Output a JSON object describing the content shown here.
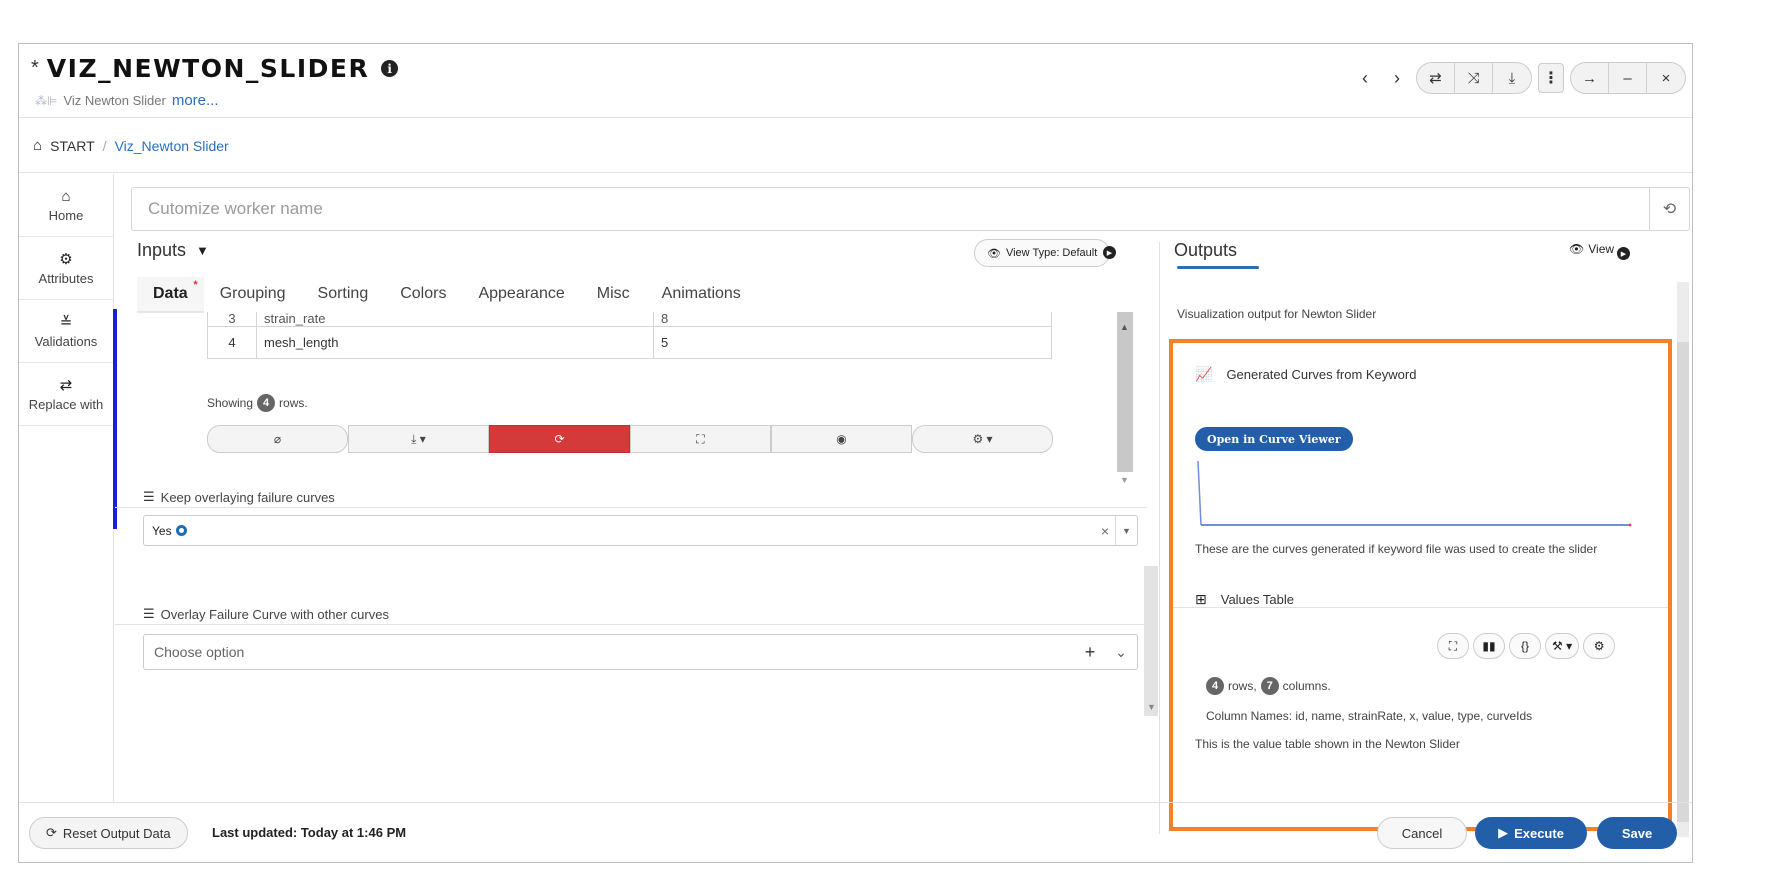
{
  "window": {
    "modified_mark": "*",
    "title": "VIZ_NEWTON_SLIDER",
    "subtitle": "Viz Newton Slider",
    "more_link": "more..."
  },
  "breadcrumb": {
    "start": "START",
    "separator": "/",
    "current": "Viz_Newton Slider"
  },
  "sidebar": {
    "items": [
      {
        "label": "Home",
        "icon": "home-icon"
      },
      {
        "label": "Attributes",
        "icon": "gear-icon"
      },
      {
        "label": "Validations",
        "icon": "double-check-icon"
      },
      {
        "label": "Replace with",
        "icon": "swap-icon"
      }
    ]
  },
  "worker": {
    "placeholder": "Cutomize worker name",
    "value": ""
  },
  "inputs": {
    "title": "Inputs",
    "view_type_label": "View Type: Default",
    "tabs": [
      "Data",
      "Grouping",
      "Sorting",
      "Colors",
      "Appearance",
      "Misc",
      "Animations"
    ],
    "active_tab": "Data",
    "table": {
      "rows": [
        {
          "idx": "3",
          "name": "strain_rate",
          "value": "8"
        },
        {
          "idx": "4",
          "name": "mesh_length",
          "value": "5"
        }
      ]
    },
    "showing_prefix": "Showing",
    "row_count": "4",
    "showing_suffix": "rows."
  },
  "fields": {
    "keep_overlay": {
      "label": "Keep overlaying failure curves",
      "value": "Yes"
    },
    "overlay_with": {
      "label": "Overlay Failure Curve with other curves",
      "placeholder": "Choose option"
    }
  },
  "outputs": {
    "title": "Outputs",
    "view_label": "View",
    "description": "Visualization output for Newton Slider",
    "curves_card": {
      "title": "Generated Curves from Keyword",
      "button": "Open in Curve Viewer",
      "note": "These are the curves generated if keyword file was used to create the slider"
    },
    "values_card": {
      "title": "Values Table",
      "rows": "4",
      "rows_label": "rows,",
      "columns": "7",
      "columns_label": "columns.",
      "column_names": "Column Names: id, name, strainRate, x, value, type, curveIds",
      "note": "This is the value table shown in the Newton Slider"
    }
  },
  "footer": {
    "reset_label": "Reset Output Data",
    "last_updated": "Last updated: Today at 1:46 PM",
    "cancel_label": "Cancel",
    "execute_label": "Execute",
    "save_label": "Save"
  },
  "colors": {
    "accent_blue": "#235fa8",
    "highlight_orange": "#f58025",
    "danger_red": "#d43a3a",
    "side_accent": "#1a1fd6"
  }
}
